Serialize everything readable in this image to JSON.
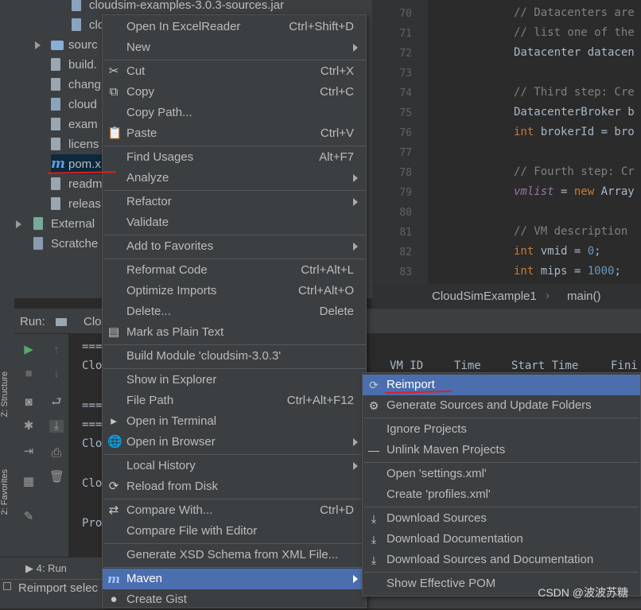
{
  "project_tree": {
    "items": [
      {
        "label": "cloudsim-examples-3.0.3-sources.jar",
        "type": "jar"
      },
      {
        "label": "clo",
        "type": "jar"
      },
      {
        "label": "sourc",
        "type": "folder"
      },
      {
        "label": "build.",
        "type": "file"
      },
      {
        "label": "chang",
        "type": "file"
      },
      {
        "label": "cloud",
        "type": "jar"
      },
      {
        "label": "exam",
        "type": "file"
      },
      {
        "label": "licens",
        "type": "file"
      },
      {
        "label": "pom.x",
        "type": "maven"
      },
      {
        "label": "readm",
        "type": "file"
      },
      {
        "label": "releas",
        "type": "file"
      },
      {
        "label": "External",
        "type": "library"
      },
      {
        "label": "Scratche",
        "type": "scratch"
      }
    ]
  },
  "editor": {
    "line_numbers": [
      "70",
      "71",
      "72",
      "73",
      "74",
      "75",
      "76",
      "77",
      "78",
      "79",
      "80",
      "81",
      "82",
      "83"
    ],
    "lines": [
      {
        "parts": [
          [
            "cm",
            "// Datacenters are"
          ]
        ]
      },
      {
        "parts": [
          [
            "cm",
            "// list one of the"
          ]
        ]
      },
      {
        "parts": [
          [
            "",
            "Datacenter datacen"
          ]
        ]
      },
      {
        "parts": []
      },
      {
        "parts": [
          [
            "cm",
            "// Third step: Cre"
          ]
        ]
      },
      {
        "parts": [
          [
            "",
            "DatacenterBroker b"
          ]
        ]
      },
      {
        "parts": [
          [
            "kw",
            "int "
          ],
          [
            "",
            "brokerId = bro"
          ]
        ]
      },
      {
        "parts": []
      },
      {
        "parts": [
          [
            "cm",
            "// Fourth step: Cr"
          ]
        ]
      },
      {
        "parts": [
          [
            "fld",
            "vmlist"
          ],
          [
            "",
            " = "
          ],
          [
            "kw",
            "new "
          ],
          [
            "",
            "Array"
          ]
        ]
      },
      {
        "parts": []
      },
      {
        "parts": [
          [
            "cm",
            "// VM description"
          ]
        ]
      },
      {
        "parts": [
          [
            "kw",
            "int "
          ],
          [
            "",
            "vmid = "
          ],
          [
            "num",
            "0"
          ],
          [
            "",
            ";"
          ]
        ]
      },
      {
        "parts": [
          [
            "kw",
            "int "
          ],
          [
            "",
            "mips = "
          ],
          [
            "num",
            "1000"
          ],
          [
            "",
            ";"
          ]
        ]
      }
    ],
    "breadcrumb": {
      "class_name": "CloudSimExample1",
      "method": "main()"
    }
  },
  "run_panel": {
    "label": "Run:",
    "tab_label": "Clo",
    "output_lines": [
      "===",
      "Clo",
      "",
      "===",
      "===",
      "Clo",
      "",
      "Clo",
      "",
      "Pro"
    ],
    "table_headers": [
      "VM ID",
      "Time",
      "Start Time",
      "Fini"
    ]
  },
  "side_tabs": {
    "structure": "Z: Structure",
    "favorites": "2: Favorites"
  },
  "bottom_tabs": {
    "run": "4: Run"
  },
  "status": {
    "text": "Reimport selec"
  },
  "context_menu": {
    "items": [
      {
        "label": "Open In ExcelReader",
        "shortcut": "Ctrl+Shift+D"
      },
      {
        "label": "New",
        "submenu": true
      },
      {
        "sep": true
      },
      {
        "label": "Cut",
        "shortcut": "Ctrl+X",
        "icon": "✂",
        "icon_name": "scissors-icon"
      },
      {
        "label": "Copy",
        "shortcut": "Ctrl+C",
        "icon": "⧉",
        "icon_name": "copy-icon"
      },
      {
        "label": "Copy Path...",
        "shortcut": ""
      },
      {
        "label": "Paste",
        "shortcut": "Ctrl+V",
        "icon": "📋",
        "icon_name": "clipboard-icon"
      },
      {
        "sep": true
      },
      {
        "label": "Find Usages",
        "shortcut": "Alt+F7"
      },
      {
        "label": "Analyze",
        "submenu": true
      },
      {
        "sep": true
      },
      {
        "label": "Refactor",
        "submenu": true
      },
      {
        "label": "Validate",
        "shortcut": ""
      },
      {
        "sep": true
      },
      {
        "label": "Add to Favorites",
        "submenu": true
      },
      {
        "sep": true
      },
      {
        "label": "Reformat Code",
        "shortcut": "Ctrl+Alt+L"
      },
      {
        "label": "Optimize Imports",
        "shortcut": "Ctrl+Alt+O"
      },
      {
        "label": "Delete...",
        "shortcut": "Delete"
      },
      {
        "label": "Mark as Plain Text",
        "shortcut": "",
        "icon": "▤",
        "icon_name": "plain-text-icon"
      },
      {
        "sep": true
      },
      {
        "label": "Build Module 'cloudsim-3.0.3'",
        "shortcut": ""
      },
      {
        "sep": true
      },
      {
        "label": "Show in Explorer",
        "shortcut": ""
      },
      {
        "label": "File Path",
        "shortcut": "Ctrl+Alt+F12"
      },
      {
        "label": "Open in Terminal",
        "shortcut": "",
        "icon": "▸",
        "icon_name": "terminal-icon"
      },
      {
        "label": "Open in Browser",
        "submenu": true,
        "icon": "🌐",
        "icon_name": "globe-icon"
      },
      {
        "sep": true
      },
      {
        "label": "Local History",
        "submenu": true
      },
      {
        "label": "Reload from Disk",
        "shortcut": "",
        "icon": "⟳",
        "icon_name": "reload-icon"
      },
      {
        "sep": true
      },
      {
        "label": "Compare With...",
        "shortcut": "Ctrl+D",
        "icon": "⇄",
        "icon_name": "compare-icon"
      },
      {
        "label": "Compare File with Editor",
        "shortcut": ""
      },
      {
        "sep": true
      },
      {
        "label": "Generate XSD Schema from XML File...",
        "shortcut": ""
      },
      {
        "sep": true
      },
      {
        "label": "Maven",
        "submenu": true,
        "selected": true,
        "icon": "m",
        "icon_name": "maven-icon"
      },
      {
        "label": "Create Gist",
        "shortcut": "",
        "icon": "●",
        "icon_name": "github-icon"
      }
    ]
  },
  "maven_submenu": {
    "items": [
      {
        "label": "Reimport",
        "selected": true,
        "icon": "⟳",
        "icon_name": "reimport-icon"
      },
      {
        "label": "Generate Sources and Update Folders",
        "icon": "⚙",
        "icon_name": "generate-sources-icon"
      },
      {
        "sep": true
      },
      {
        "label": "Ignore Projects"
      },
      {
        "label": "Unlink Maven Projects",
        "icon": "—",
        "icon_name": "unlink-icon"
      },
      {
        "sep": true
      },
      {
        "label": "Open 'settings.xml'"
      },
      {
        "label": "Create 'profiles.xml'"
      },
      {
        "sep": true
      },
      {
        "label": "Download Sources",
        "icon": "⤓",
        "icon_name": "download-icon"
      },
      {
        "label": "Download Documentation",
        "icon": "⤓",
        "icon_name": "download-icon"
      },
      {
        "label": "Download Sources and Documentation",
        "icon": "⤓",
        "icon_name": "download-icon"
      },
      {
        "sep": true
      },
      {
        "label": "Show Effective POM"
      }
    ]
  },
  "watermark": "CSDN @波波苏糖"
}
